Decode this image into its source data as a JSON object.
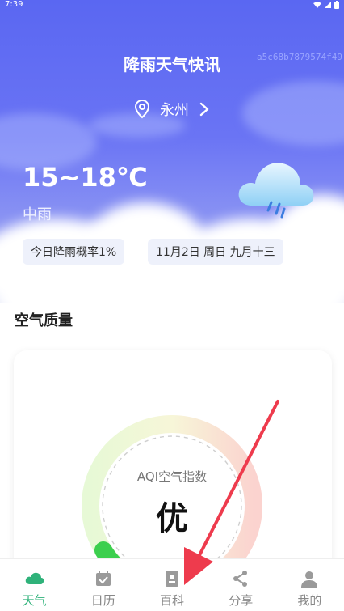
{
  "status": {
    "time": "7:39"
  },
  "header": {
    "title": "降雨天气快讯",
    "hash": "a5c68b7879574f49"
  },
  "location": {
    "name": "永州"
  },
  "weather": {
    "temp": "15~18℃",
    "condition": "中雨",
    "rain_chip": "今日降雨概率1%",
    "date_chip": "11月2日 周日 九月十三"
  },
  "air": {
    "section_title": "空气质量",
    "aqi_label": "AQI空气指数",
    "aqi_value": "优"
  },
  "tabs": [
    {
      "label": "天气",
      "icon": "cloud-icon",
      "active": true
    },
    {
      "label": "日历",
      "icon": "calendar-icon",
      "active": false
    },
    {
      "label": "百科",
      "icon": "book-icon",
      "active": false
    },
    {
      "label": "分享",
      "icon": "share-icon",
      "active": false
    },
    {
      "label": "我的",
      "icon": "user-icon",
      "active": false
    }
  ],
  "colors": {
    "accent": "#2fb27a",
    "hero_top": "#5a67f2",
    "arrow": "#ee3b4d"
  }
}
